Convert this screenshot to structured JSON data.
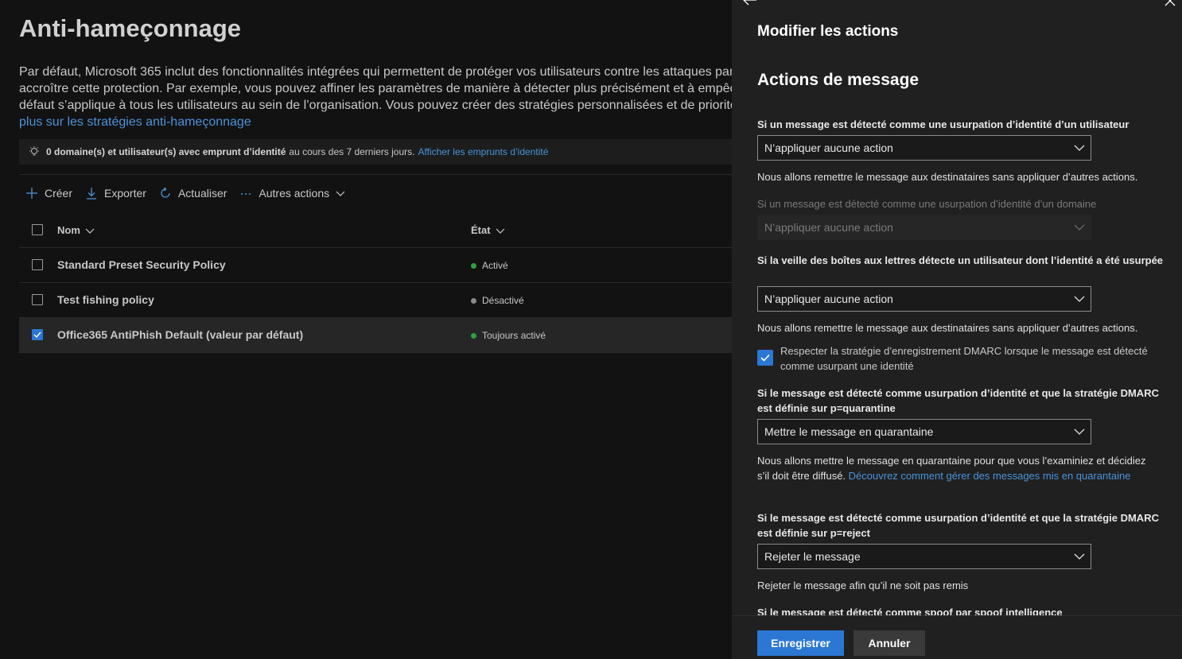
{
  "page": {
    "title": "Anti-hameçonnage",
    "description_lines": [
      "Par défaut, Microsoft 365 inclut des fonctionnalités intégrées qui permettent de protéger vos utilisateurs contre les attaques par",
      "accroître cette protection. Par exemple, vous pouvez affiner les paramètres de manière à détecter plus précisément et à empêch",
      "défaut s’applique à tous les utilisateurs au sein de l’organisation. Vous pouvez créer des stratégies personnalisées et de priorité"
    ],
    "description_link": "plus sur les stratégies anti-hameçonnage"
  },
  "info_bar": {
    "icon": "lightbulb-icon",
    "bold_text": "0 domaine(s) et utilisateur(s) avec emprunt d’identité",
    "text": "au cours des 7 derniers jours.",
    "link": "Afficher les emprunts d’identité"
  },
  "toolbar": {
    "create": "Créer",
    "export": "Exporter",
    "refresh": "Actualiser",
    "more": "Autres actions"
  },
  "table": {
    "headers": {
      "name": "Nom",
      "state": "État"
    },
    "rows": [
      {
        "name": "Standard Preset Security Policy",
        "state": "Activé",
        "state_color": "#2ea043",
        "checked": false
      },
      {
        "name": "Test fishing policy",
        "state": "Désactivé",
        "state_color": "#8a8a8a",
        "checked": false
      },
      {
        "name": "Office365 AntiPhish Default (valeur par défaut)",
        "state": "Toujours activé",
        "state_color": "#2ea043",
        "checked": true
      }
    ]
  },
  "panel": {
    "title": "Modifier les actions",
    "section_title": "Actions de message",
    "user_label": "Si un message est détecté comme une usurpation d’identité d’un utilisateur",
    "user_value": "N’appliquer aucune action",
    "user_note": "Nous allons remettre le message aux destinataires sans appliquer d’autres actions.",
    "domain_label": "Si un message est détecté comme une usurpation d’identité d’un domaine",
    "domain_value": "N’appliquer aucune action",
    "mailbox_label": "Si la veille des boîtes aux lettres détecte un utilisateur dont l’identité a été usurpée",
    "mailbox_value": "N’appliquer aucune action",
    "mailbox_note": "Nous allons remettre le message aux destinataires sans appliquer d’autres actions.",
    "dmarc_checkbox_label": "Respecter la stratégie d’enregistrement DMARC lorsque le message est détecté comme usurpant une identité",
    "quarantine_label": "Si le message est détecté comme usurpation d’identité et que la stratégie DMARC est définie sur p=quarantine",
    "quarantine_value": "Mettre le message en quarantaine",
    "quarantine_note": "Nous allons mettre le message en quarantaine pour que vous l’examiniez et décidiez s’il doit être diffusé.",
    "quarantine_link": "Découvrez comment gérer des messages mis en quarantaine",
    "reject_label": "Si le message est détecté comme usurpation d’identité et que la stratégie DMARC est définie sur p=reject",
    "reject_value": "Rejeter le message",
    "reject_note": "Rejeter le message afin qu’il ne soit pas remis",
    "spoof_label": "Si le message est détecté comme spoof par spoof intelligence",
    "save": "Enregistrer",
    "cancel": "Annuler"
  },
  "colors": {
    "accent": "#2b78d4",
    "link": "#4a93d9",
    "active": "#2ea043",
    "inactive": "#8a8a8a"
  }
}
